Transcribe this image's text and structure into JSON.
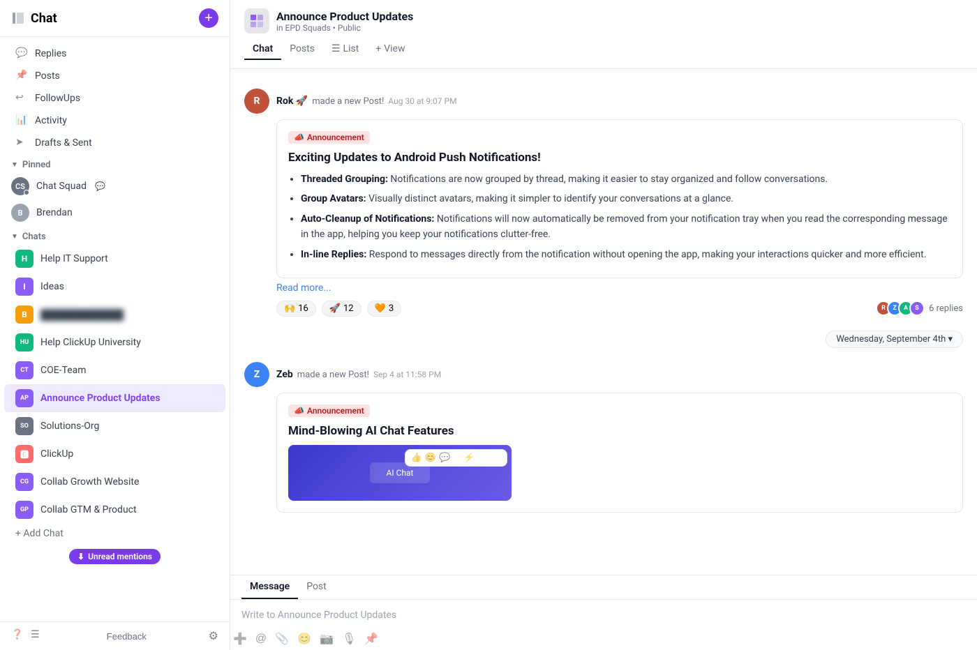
{
  "sidebar": {
    "title": "Chat",
    "addBtn": "+",
    "nav": [
      {
        "id": "replies",
        "label": "Replies",
        "icon": "💬"
      },
      {
        "id": "posts",
        "label": "Posts",
        "icon": "📌"
      },
      {
        "id": "followups",
        "label": "FollowUps",
        "icon": "↩"
      },
      {
        "id": "activity",
        "label": "Activity",
        "icon": "📊"
      },
      {
        "id": "drafts",
        "label": "Drafts & Sent",
        "icon": "➤"
      }
    ],
    "pinnedSection": "Pinned",
    "pinnedItems": [
      {
        "id": "chat-squad",
        "label": "Chat Squad",
        "initials": "CS",
        "color": "#6b7280",
        "badge": true
      },
      {
        "id": "brendan",
        "label": "Brendan",
        "initials": "B",
        "color": "#9ca3af",
        "badge": false
      }
    ],
    "chatsSection": "Chats",
    "chatItems": [
      {
        "id": "help-it",
        "label": "Help IT Support",
        "color": "#10b981",
        "initials": "H"
      },
      {
        "id": "ideas",
        "label": "Ideas",
        "color": "#8b5cf6",
        "initials": "I"
      },
      {
        "id": "blurred",
        "label": "••••• ••••••••",
        "color": "#f59e0b",
        "initials": "B",
        "blurred": true
      },
      {
        "id": "help-clickup",
        "label": "Help ClickUp University",
        "color": "#10b981",
        "initials": "HU"
      },
      {
        "id": "coe-team",
        "label": "COE-Team",
        "color": "#8b5cf6",
        "initials": "CT"
      },
      {
        "id": "announce",
        "label": "Announce Product Updates",
        "color": "#8b5cf6",
        "initials": "AP",
        "active": true
      },
      {
        "id": "solutions-org",
        "label": "Solutions-Org",
        "color": "#6b7280",
        "initials": "SO"
      },
      {
        "id": "clickup",
        "label": "ClickUp",
        "color": "#ff6b6b",
        "initials": "CU"
      },
      {
        "id": "collab-growth",
        "label": "Collab Growth Website",
        "color": "#8b5cf6",
        "initials": "CG"
      },
      {
        "id": "collab-gtm",
        "label": "Collab GTM & Product",
        "color": "#8b5cf6",
        "initials": "GP"
      }
    ],
    "addChat": "+ Add Chat",
    "unreadMentions": "Unread mentions",
    "feedback": "Feedback"
  },
  "channel": {
    "name": "Announce Product Updates",
    "meta": "in EPD Squads • Public",
    "tabs": [
      "Chat",
      "Posts",
      "List",
      "View"
    ],
    "activeTab": "Chat"
  },
  "messages": [
    {
      "id": "msg1",
      "author": "Rok 🚀",
      "action": "made a new Post!",
      "time": "Aug 30 at 9:07 PM",
      "avatarInitials": "R",
      "avatarClass": "rok",
      "tag": "📣 Announcement",
      "postTitle": "Exciting Updates to Android Push Notifications!",
      "postBody": [
        {
          "bold": "Threaded Grouping:",
          "text": " Notifications are now grouped by thread, making it easier to stay organized and follow conversations."
        },
        {
          "bold": "Group Avatars:",
          "text": " Visually distinct avatars, making it simpler to identify your conversations at a glance."
        },
        {
          "bold": "Auto-Cleanup of Notifications:",
          "text": " Notifications will now automatically be removed from your notification tray when you read the corresponding message in the app, helping you keep your notifications clutter-free."
        },
        {
          "bold": "In-line Replies:",
          "text": " Respond to messages directly from the notification without opening the app, making your interactions quicker and more efficient."
        }
      ],
      "readMore": "Read more...",
      "reactions": [
        {
          "emoji": "🙌",
          "count": "16"
        },
        {
          "emoji": "🚀",
          "count": "12"
        },
        {
          "emoji": "🧡",
          "count": "3"
        }
      ],
      "replyCount": "6 replies",
      "replyAvatars": [
        "#c0513a",
        "#3b82f6",
        "#10b981",
        "#8b5cf6"
      ]
    },
    {
      "id": "msg2",
      "author": "Zeb",
      "action": "made a new Post!",
      "time": "Sep 4 at 11:58 PM",
      "avatarInitials": "Z",
      "avatarClass": "zeb",
      "tag": "📣 Announcement",
      "postTitle": "Mind-Blowing AI Chat Features",
      "hasImage": true
    }
  ],
  "dateDivider": "Wednesday, September 4th ▾",
  "input": {
    "tabs": [
      "Message",
      "Post"
    ],
    "activeTab": "Message",
    "placeholder": "Write to Announce Product Updates",
    "toolbarIcons": [
      "➕",
      "@",
      "📎",
      "😊",
      "📷",
      "🎙",
      "📌"
    ]
  }
}
